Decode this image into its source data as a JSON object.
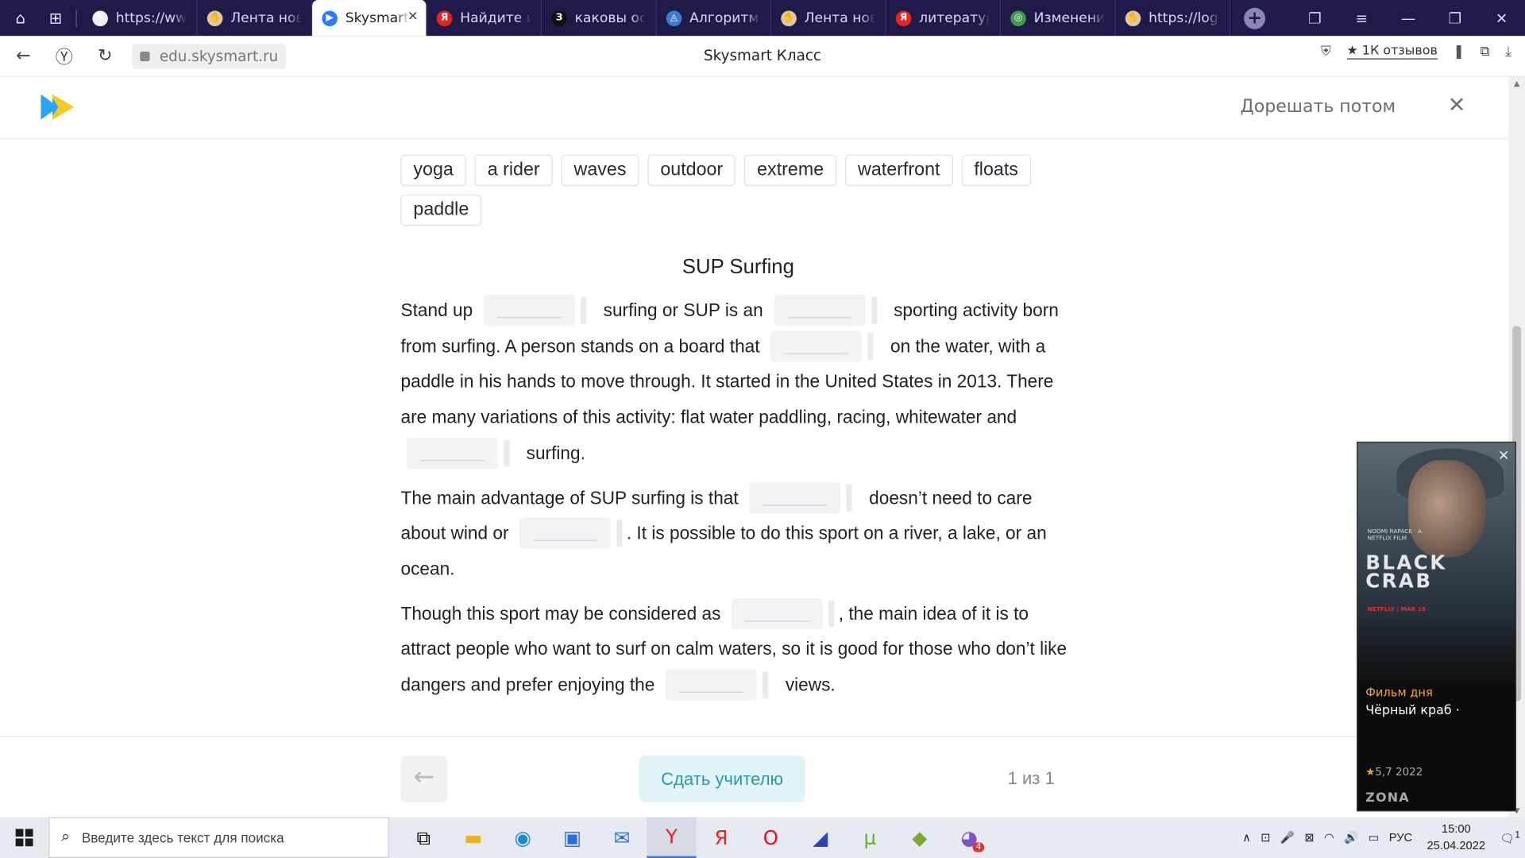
{
  "browser": {
    "tabs": [
      {
        "title": "https://www",
        "color": "#f0f0f0",
        "glyph": "✎"
      },
      {
        "title": "Лента ново",
        "color": "#e6c8a0",
        "glyph": "✋"
      },
      {
        "title": "Skysmart",
        "color": "#2f7bff",
        "glyph": "▶",
        "active": true
      },
      {
        "title": "Найдите ин",
        "color": "#e52620",
        "glyph": "Я"
      },
      {
        "title": "каковы осн",
        "color": "#111111",
        "glyph": "З"
      },
      {
        "title": "Алгоритмы",
        "color": "#3a7bd5",
        "glyph": "◬"
      },
      {
        "title": "Лента ново",
        "color": "#e6c8a0",
        "glyph": "✋"
      },
      {
        "title": "литература",
        "color": "#e52620",
        "glyph": "Я"
      },
      {
        "title": "Изменения",
        "color": "#3d9b4a",
        "glyph": "◎"
      },
      {
        "title": "https://login",
        "color": "#e6c8a0",
        "glyph": "✋"
      }
    ],
    "url": "edu.skysmart.ru",
    "page_title": "Skysmart Класс",
    "reviews": "★ 1К отзывов"
  },
  "header": {
    "later": "Дорешать потом",
    "close": "✕"
  },
  "exercise": {
    "chips": [
      "yoga",
      "a rider",
      "waves",
      "outdoor",
      "extreme",
      "waterfront",
      "floats",
      "paddle"
    ],
    "heading": "SUP Surfing",
    "p1": {
      "t1": "Stand up",
      "t2": "surfing or SUP is an",
      "t3": "sporting activity born from surfing. A person stands on a board that",
      "t4": "on the water, with a paddle in his hands to move through. It started in the United States in 2013. There are many variations of this activity: flat water paddling, racing, whitewater and",
      "t5": "surfing."
    },
    "p2": {
      "t1": "The main advantage of SUP surfing is that",
      "t2": "doesn’t need to care about wind or",
      "t3": ". It is possible to do this sport on a river, a lake, or an ocean."
    },
    "p3": {
      "t1": "Though this sport may be considered as",
      "t2": ", the main idea of it is to attract people who want to surf on calm waters, so it is good for those who don’t like dangers and prefer enjoying the",
      "t3": "views."
    }
  },
  "footer": {
    "back": "←",
    "submit": "Сдать учителю",
    "pager": "1 из 1"
  },
  "ad": {
    "small_text": "NOOMI RAPACE · A NETFLIX FILM",
    "title_big": "BLACK CRAB",
    "netflix": "NETFLIX | MAR 18",
    "label": "Фильм дня",
    "title": "Чёрный краб ·",
    "rating": "5,7",
    "year": "2022",
    "brand": "ZONA"
  },
  "taskbar": {
    "search_placeholder": "Введите здесь текст для поиска",
    "lang": "РУС",
    "time": "15:00",
    "date": "25.04.2022",
    "badge": "4",
    "notif": "1"
  }
}
